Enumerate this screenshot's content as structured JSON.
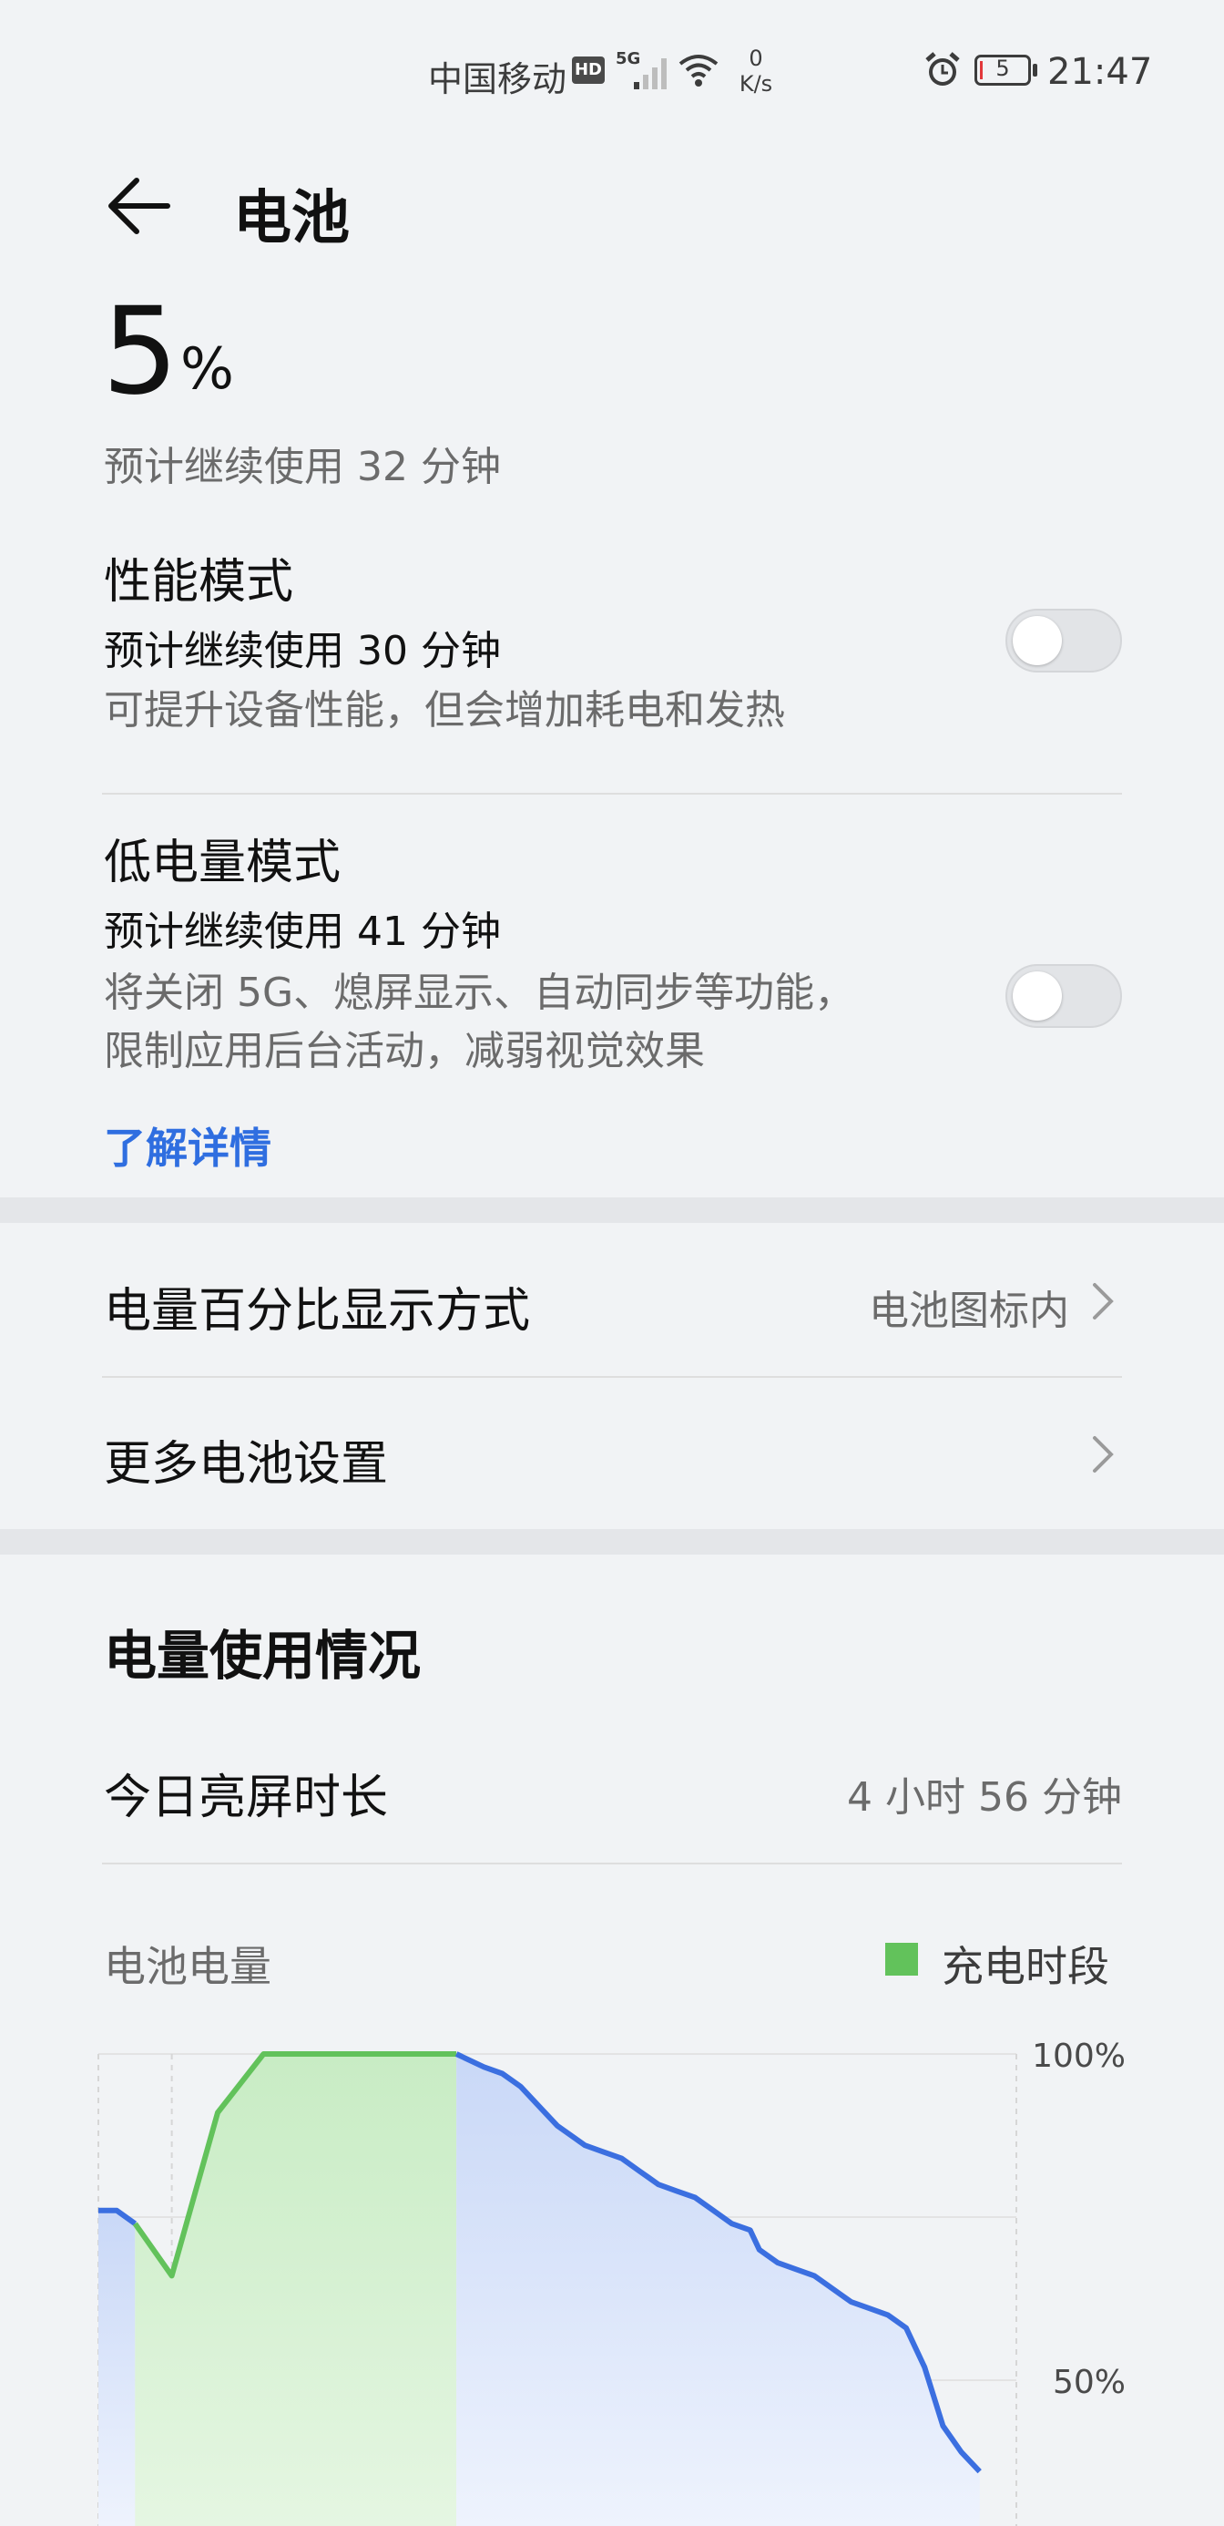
{
  "status_bar": {
    "carrier": "中国移动",
    "hd_badge": "HD",
    "network_badge": "5G",
    "net_speed_value": "0",
    "net_speed_unit": "K/s",
    "battery_level": "5",
    "time": "21:47",
    "icons": [
      "signal-icon",
      "wifi-icon",
      "alarm-icon",
      "battery-icon"
    ]
  },
  "header": {
    "title": "电池",
    "back_icon": "back-arrow-icon"
  },
  "battery": {
    "percent": "5",
    "percent_unit": "%",
    "estimate": "预计继续使用 32 分钟"
  },
  "performance_mode": {
    "title": "性能模式",
    "estimate": "预计继续使用 30 分钟",
    "description": "可提升设备性能，但会增加耗电和发热",
    "enabled": false
  },
  "low_power_mode": {
    "title": "低电量模式",
    "estimate": "预计继续使用 41 分钟",
    "description_line1": "将关闭 5G、熄屏显示、自动同步等功能，",
    "description_line2": "限制应用后台活动，减弱视觉效果",
    "enabled": false,
    "learn_more": "了解详情"
  },
  "settings": {
    "percentage_display": {
      "label": "电量百分比显示方式",
      "value": "电池图标内"
    },
    "more_settings": {
      "label": "更多电池设置"
    }
  },
  "usage": {
    "title": "电量使用情况",
    "screen_time_label": "今日亮屏时长",
    "screen_time_value": "4 小时 56 分钟"
  },
  "chart_data": {
    "type": "area",
    "title": "电池电量",
    "legend": [
      {
        "name": "充电时段",
        "color": "#62c25b"
      }
    ],
    "ylim": [
      0,
      100
    ],
    "y_ticks": [
      "100%",
      "50%"
    ],
    "grid": true,
    "colors": {
      "discharge_line": "#3b6fe0",
      "discharge_fill": "#c9d8f7",
      "charge_line": "#62c25b",
      "charge_fill": "#c8ecc4"
    },
    "x": [
      0,
      2,
      4,
      8,
      13,
      18,
      39,
      42,
      44,
      46,
      48,
      50,
      52,
      53,
      55,
      57,
      59,
      60,
      61,
      63,
      65,
      67,
      69,
      71,
      72,
      74,
      76,
      78,
      79,
      81,
      82,
      84,
      86,
      88,
      90,
      92,
      94,
      96
    ],
    "values": [
      76,
      76,
      74,
      66,
      91,
      100,
      100,
      98,
      97,
      95,
      92,
      89,
      87,
      86,
      85,
      84,
      82,
      81,
      80,
      79,
      78,
      76,
      74,
      73,
      70,
      68,
      67,
      66,
      65,
      63,
      62,
      61,
      60,
      58,
      52,
      43,
      39,
      36
    ],
    "charge_periods": [
      [
        4,
        39
      ]
    ]
  }
}
